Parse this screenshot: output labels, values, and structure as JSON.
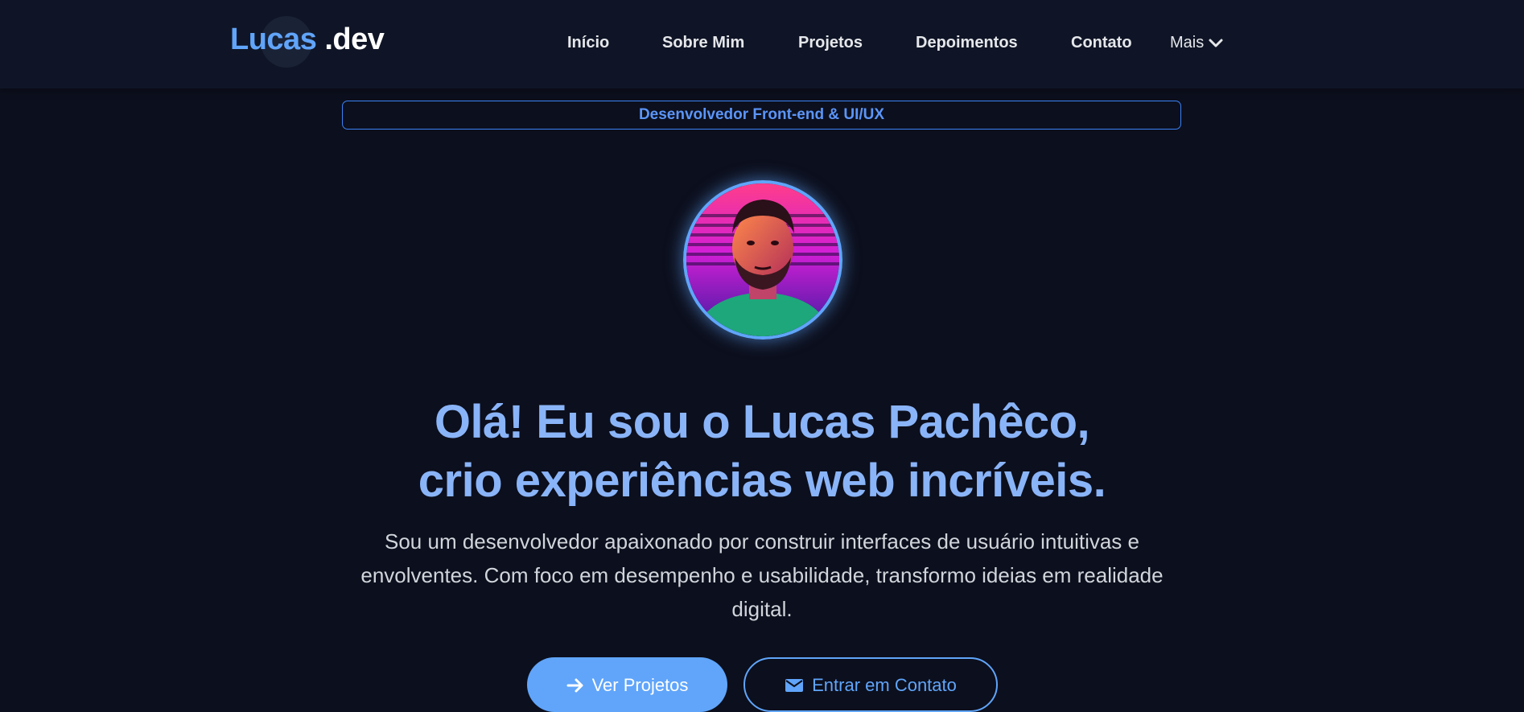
{
  "header": {
    "logo_name": "Lucas",
    "logo_suffix": ".dev",
    "nav": [
      {
        "label": "Início"
      },
      {
        "label": "Sobre Mim"
      },
      {
        "label": "Projetos"
      },
      {
        "label": "Depoimentos"
      },
      {
        "label": "Contato"
      }
    ],
    "more_label": "Mais",
    "more_icon": "chevron-down-icon"
  },
  "hero": {
    "badge": "Desenvolvedor Front-end & UI/UX",
    "avatar_alt": "Lucas Pachêco",
    "title_line1": "Olá! Eu sou o Lucas Pachêco,",
    "title_line2": "crio experiências web incríveis.",
    "subtitle": "Sou um desenvolvedor apaixonado por construir interfaces de usuário intuitivas e envolventes. Com foco em desempenho e usabilidade, transformo ideias em realidade digital.",
    "primary_button": {
      "label": "Ver Projetos",
      "icon": "arrow-right-icon"
    },
    "secondary_button": {
      "label": "Entrar em Contato",
      "icon": "envelope-icon"
    }
  },
  "colors": {
    "background": "#0c0f1d",
    "navbar": "#0f1526",
    "accent": "#60a5fa",
    "title": "#8ab4f8",
    "text": "#d1d5db"
  }
}
